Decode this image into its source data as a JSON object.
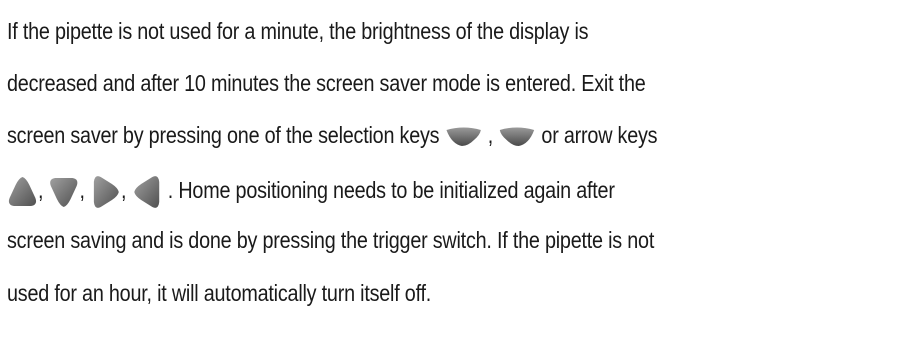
{
  "paragraph": {
    "line1": "If the pipette is not used for a minute, the brightness of the display is",
    "line2": "decreased and after 10 minutes the screen saver mode is entered. Exit the",
    "line3_before": "screen saver by pressing one of the selection keys ",
    "line3_sep": " , ",
    "line3_after": " or arrow keys",
    "line4_sep": ",",
    "line4_after": ". Home positioning needs to be initialized again after",
    "line5": "screen saving and  is done by pressing the trigger switch. If the pipette is not",
    "line6": "used for an hour, it will automatically turn itself off."
  },
  "icons": {
    "selection_keys": [
      "left-selection-key-icon",
      "right-selection-key-icon"
    ],
    "arrow_keys": [
      "arrow-up-key-icon",
      "arrow-down-key-icon",
      "arrow-right-key-icon",
      "arrow-left-key-icon"
    ],
    "key_color": "#6e6e6e"
  }
}
